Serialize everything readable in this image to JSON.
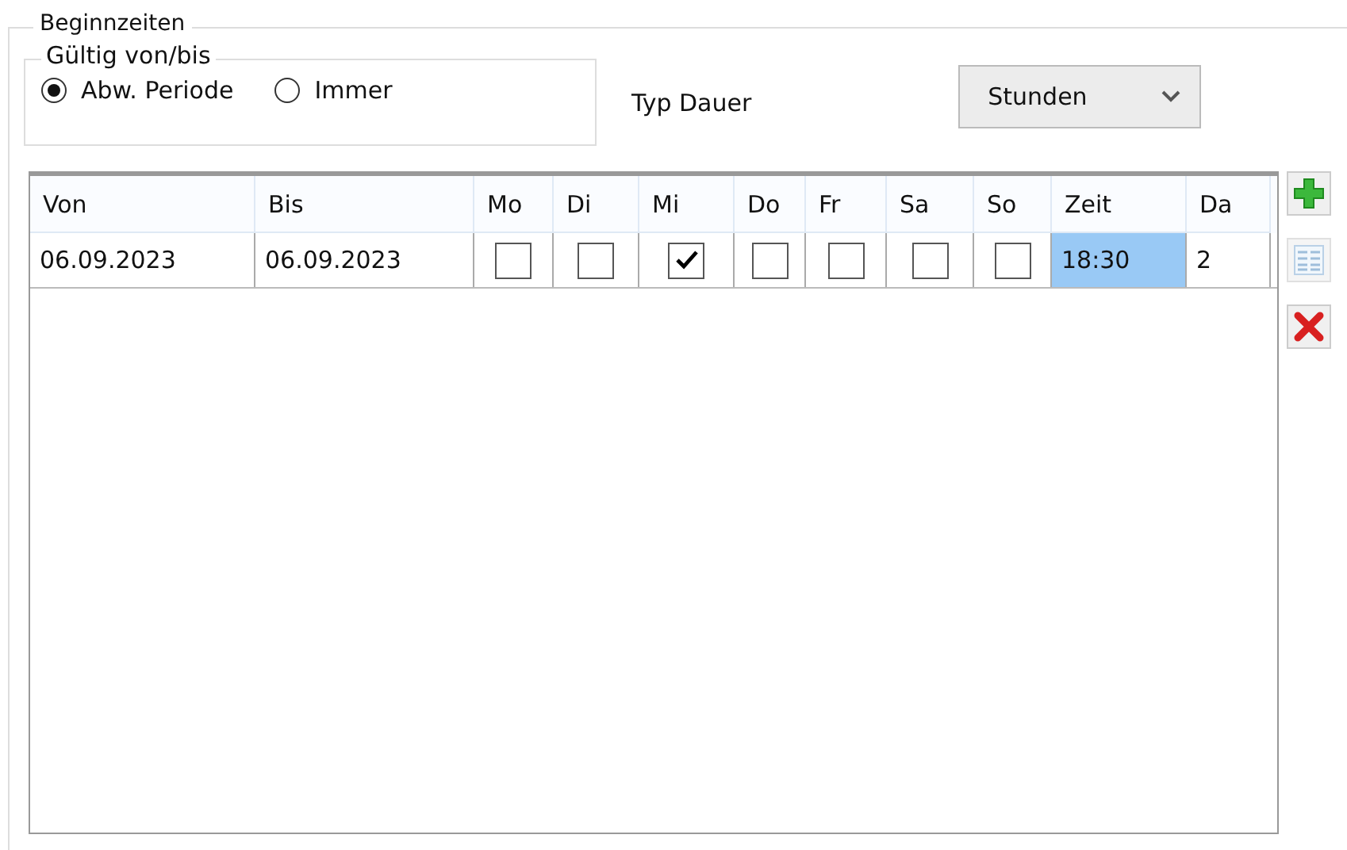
{
  "group": {
    "title": "Beginnzeiten"
  },
  "validity": {
    "title": "Gültig von/bis",
    "options": [
      {
        "label": "Abw. Periode",
        "selected": true
      },
      {
        "label": "Immer",
        "selected": false
      }
    ]
  },
  "duration_type": {
    "label": "Typ Dauer",
    "value": "Stunden"
  },
  "table": {
    "columns": [
      "Von",
      "Bis",
      "Mo",
      "Di",
      "Mi",
      "Do",
      "Fr",
      "Sa",
      "So",
      "Zeit",
      "Da"
    ],
    "rows": [
      {
        "cells": [
          {
            "kind": "text",
            "text": "06.09.2023",
            "selected": false
          },
          {
            "kind": "text",
            "text": "06.09.2023",
            "selected": false
          },
          {
            "kind": "check",
            "checked": false
          },
          {
            "kind": "check",
            "checked": false
          },
          {
            "kind": "check",
            "checked": true
          },
          {
            "kind": "check",
            "checked": false
          },
          {
            "kind": "check",
            "checked": false
          },
          {
            "kind": "check",
            "checked": false
          },
          {
            "kind": "check",
            "checked": false
          },
          {
            "kind": "text",
            "text": "18:30",
            "selected": true
          },
          {
            "kind": "text",
            "text": "2",
            "selected": false
          }
        ]
      }
    ]
  },
  "side_buttons": [
    {
      "kind": "add",
      "disabled": false
    },
    {
      "kind": "list",
      "disabled": true
    },
    {
      "kind": "delete",
      "disabled": false
    }
  ]
}
